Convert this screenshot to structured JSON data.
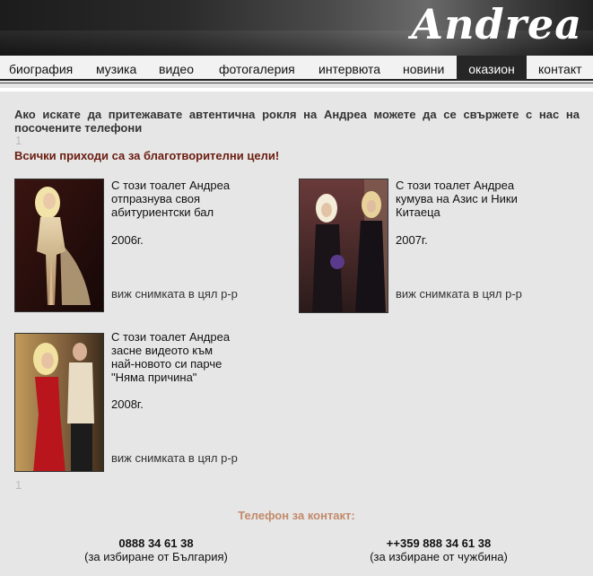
{
  "brand": "Andrea",
  "nav": [
    {
      "label": "биография"
    },
    {
      "label": "музика"
    },
    {
      "label": "видео"
    },
    {
      "label": "фотогалерия"
    },
    {
      "label": "интервюта"
    },
    {
      "label": "новини"
    },
    {
      "label": "оказион",
      "active": true
    },
    {
      "label": "контакт"
    }
  ],
  "intro": "Ако искате да притежавате автентична рокля на Андреа можете да се свържете с нас на посочените телефони",
  "marker_top": "1",
  "marker_bottom": "1",
  "charity": "Всички приходи са за благотворителни цели!",
  "items": [
    {
      "caption": "С този тоалет Андреа отпразнува своя абитуриентски бал",
      "year": "2006г.",
      "link": "виж снимката в цял р-р"
    },
    {
      "caption": "С този тоалет Андреа кумува на Азис и Ники Китаеца",
      "year": "2007г.",
      "link": "виж снимката в цял р-р"
    },
    {
      "caption": "С този тоалет Андреа засне видеото към най-новото си парче \"Няма причина\"",
      "year": "2008г.",
      "link": "виж снимката в цял р-р"
    }
  ],
  "contact": {
    "title": "Телефон за контакт:",
    "phones": [
      {
        "number": "0888 34 61 38",
        "note": "(за избиране от България)"
      },
      {
        "number": "++359 888 34 61 38",
        "note": "(за избиране от чужбина)"
      }
    ]
  },
  "colors": {
    "charity": "#6b1d10",
    "contact_title": "#c28a6a",
    "nav_active": "#262626"
  }
}
